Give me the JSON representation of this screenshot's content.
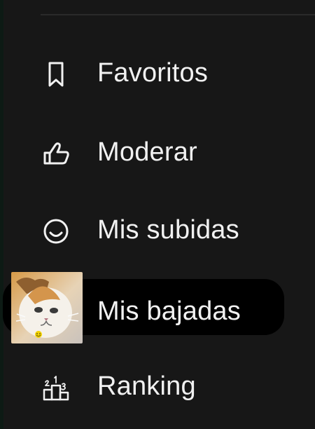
{
  "menu": {
    "items": [
      {
        "label": "Favoritos",
        "icon": "bookmark-icon"
      },
      {
        "label": "Moderar",
        "icon": "thumbs-up-icon"
      },
      {
        "label": "Mis subidas",
        "icon": "smile-icon"
      },
      {
        "label": "Mis bajadas",
        "icon": "user-avatar-icon",
        "selected": true
      },
      {
        "label": "Ranking",
        "icon": "podium-icon"
      }
    ]
  },
  "colors": {
    "background": "#171717",
    "text": "#f1f1f1",
    "selected_background": "#000000"
  }
}
